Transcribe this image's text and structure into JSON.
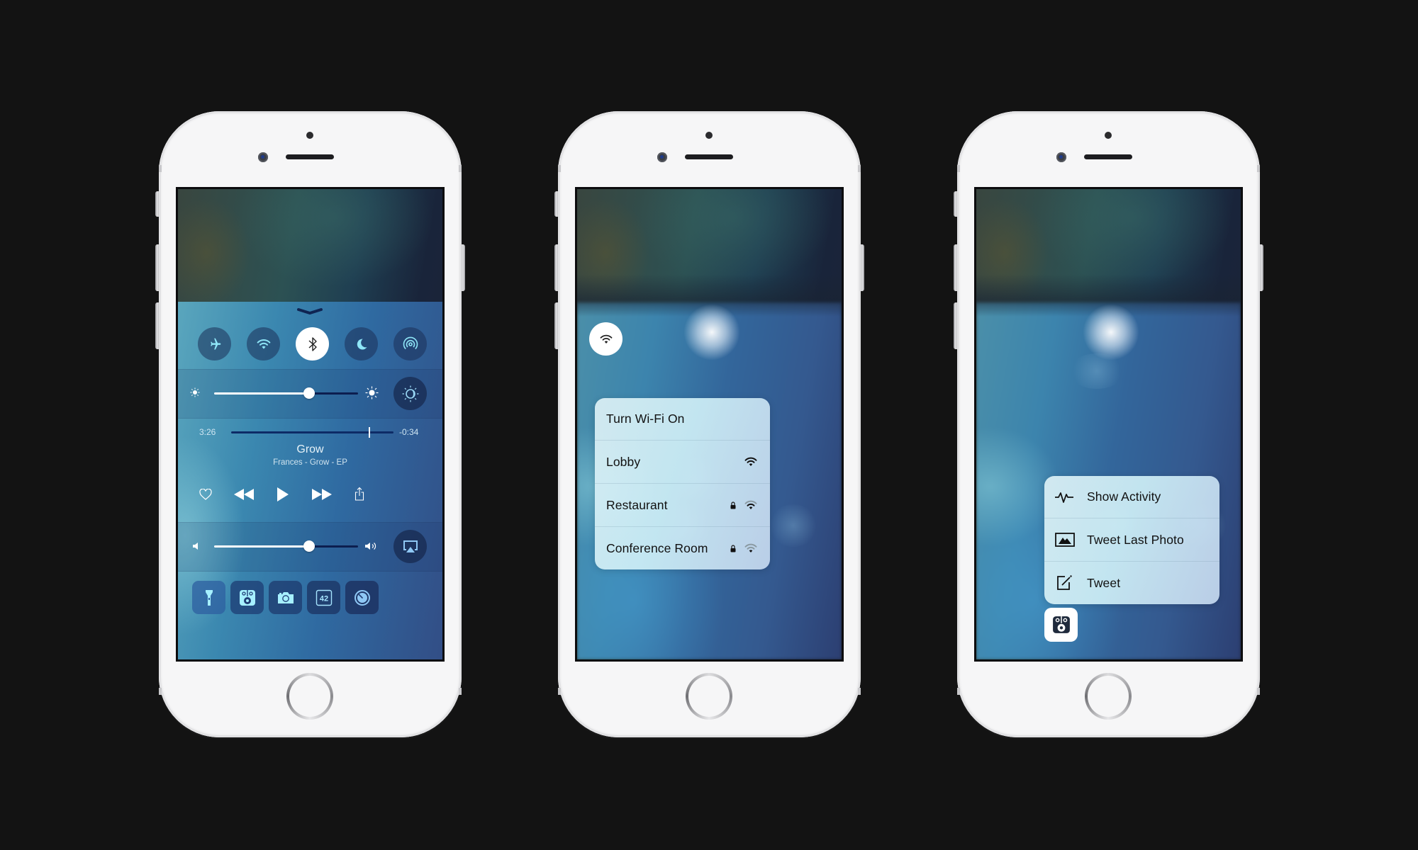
{
  "phones": [
    {
      "id": "control-center",
      "control_center": {
        "toggles": [
          {
            "name": "airplane-mode",
            "icon": "airplane-icon",
            "state": "off"
          },
          {
            "name": "wifi",
            "icon": "wifi-icon",
            "state": "off"
          },
          {
            "name": "bluetooth",
            "icon": "bluetooth-icon",
            "state": "on"
          },
          {
            "name": "do-not-disturb",
            "icon": "moon-icon",
            "state": "off"
          },
          {
            "name": "airdrop",
            "icon": "airdrop-icon",
            "state": "off"
          }
        ],
        "brightness": {
          "value": 0.66,
          "min_icon": "sun-small-icon",
          "max_icon": "sun-large-icon",
          "night_shift_icon": "night-shift-icon"
        },
        "now_playing": {
          "elapsed": "3:26",
          "remaining": "-0:34",
          "progress": 0.85,
          "title": "Grow",
          "subtitle": "Frances - Grow - EP",
          "controls": [
            "heart-icon",
            "rewind-icon",
            "play-icon",
            "fast-forward-icon",
            "share-icon"
          ]
        },
        "volume": {
          "value": 0.66,
          "min_icon": "speaker-low-icon",
          "max_icon": "speaker-high-icon",
          "airplay_icon": "airplay-icon"
        },
        "shortcuts": [
          {
            "name": "flashlight",
            "icon": "flashlight-icon"
          },
          {
            "name": "speaker-app",
            "icon": "speaker-app-icon"
          },
          {
            "name": "camera",
            "icon": "camera-icon"
          },
          {
            "name": "calculator",
            "icon": "calculator-icon",
            "label": "42"
          },
          {
            "name": "timer",
            "icon": "timer-icon"
          }
        ]
      }
    },
    {
      "id": "wifi-quick-actions",
      "pop_icon": "wifi-icon",
      "menu": [
        {
          "label": "Turn Wi-Fi On",
          "locked": false,
          "signal": null
        },
        {
          "label": "Lobby",
          "locked": false,
          "signal": "strong"
        },
        {
          "label": "Restaurant",
          "locked": true,
          "signal": "medium"
        },
        {
          "label": "Conference Room",
          "locked": true,
          "signal": "weak"
        }
      ]
    },
    {
      "id": "app-quick-actions",
      "app_icon": "speaker-app-icon",
      "menu": [
        {
          "label": "Show Activity",
          "icon": "activity-icon"
        },
        {
          "label": "Tweet Last Photo",
          "icon": "photo-icon"
        },
        {
          "label": "Tweet",
          "icon": "compose-icon"
        }
      ]
    }
  ],
  "colors": {
    "background": "#131313",
    "phone_body": "#f6f6f7",
    "cc_icon_accent": "#8fe6f7",
    "slider_fill": "#ffffff",
    "slider_rest": "#0c1e4f",
    "menu_text": "#111111"
  }
}
